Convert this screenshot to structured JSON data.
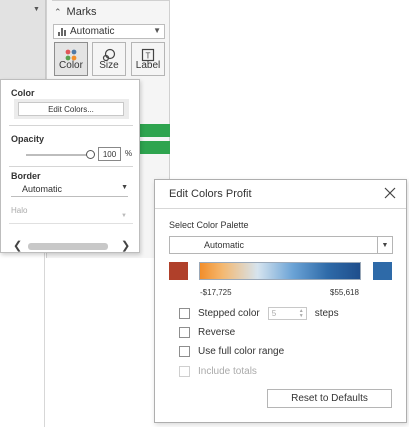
{
  "marks": {
    "title": "Marks",
    "mark_type": "Automatic",
    "buttons": [
      {
        "label": "Color",
        "icon": "color-dots-icon"
      },
      {
        "label": "Size",
        "icon": "size-icon"
      },
      {
        "label": "Label",
        "icon": "label-icon"
      }
    ]
  },
  "color_popup": {
    "color_title": "Color",
    "edit_colors_label": "Edit Colors...",
    "opacity_title": "Opacity",
    "opacity_value": "100",
    "opacity_unit": "%",
    "opacity_level_percent": 100,
    "border_title": "Border",
    "border_value": "Automatic",
    "halo_title": "Halo"
  },
  "dialog": {
    "title": "Edit Colors Profit",
    "palette_label": "Select Color Palette",
    "palette_value": "Automatic",
    "negative_color": "#b0402a",
    "positive_color": "#2e6aa8",
    "range_min": "-$17,725",
    "range_max": "$55,618",
    "stepped_color_label": "Stepped color",
    "steps_value": "5",
    "steps_label": "steps",
    "reverse_label": "Reverse",
    "full_range_label": "Use full color range",
    "include_totals_label": "Include totals",
    "reset_label": "Reset to Defaults"
  },
  "colors": {
    "pill_green": "#2ea44f",
    "gradient": [
      "#f28e2b",
      "#f4b870",
      "#d6e4ef",
      "#6ba3d6",
      "#2e6aa8",
      "#1f4e8c"
    ]
  }
}
